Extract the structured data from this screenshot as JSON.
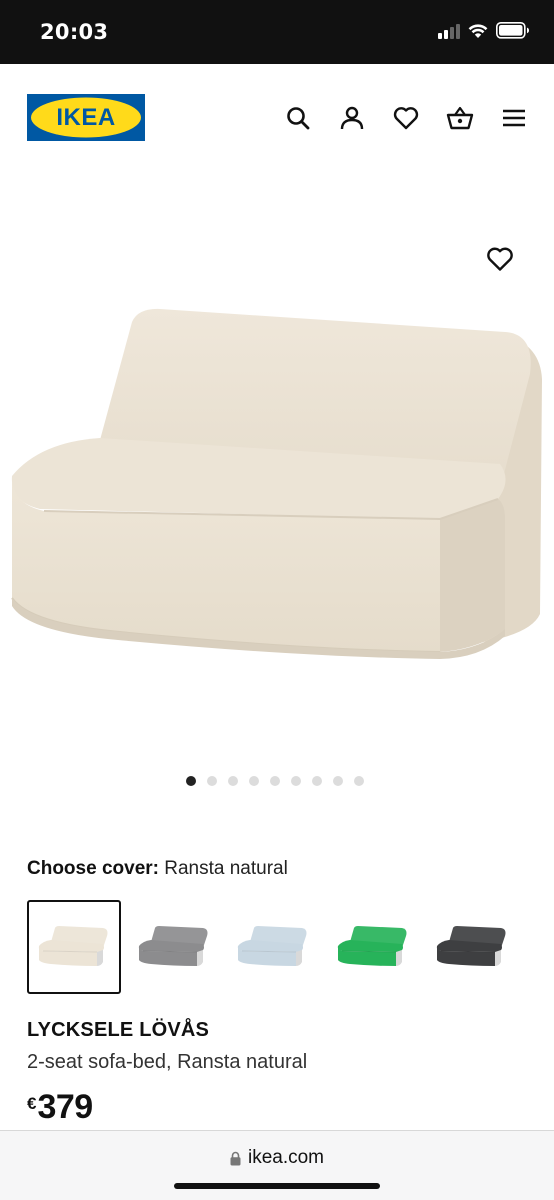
{
  "status_bar": {
    "time": "20:03"
  },
  "header": {
    "logo_text": "IKEA",
    "icons": [
      "search-icon",
      "account-icon",
      "favourites-icon",
      "basket-icon",
      "menu-icon"
    ],
    "brand_blue": "#0058A3",
    "brand_yellow": "#FFDA1A"
  },
  "gallery": {
    "dot_count": 9,
    "active_index": 0
  },
  "cover": {
    "label": "Choose cover:",
    "selected": "Ransta natural",
    "swatches": [
      {
        "name": "Ransta natural",
        "color": "#ece4d6"
      },
      {
        "name": "grey",
        "color": "#8c8c8e"
      },
      {
        "name": "patterned blue",
        "color": "#c8d7e2"
      },
      {
        "name": "green",
        "color": "#27b35a"
      },
      {
        "name": "dark grey",
        "color": "#3e3f41"
      }
    ]
  },
  "product": {
    "name": "LYCKSELE LÖVÅS",
    "description": "2-seat sofa-bed, Ransta natural",
    "currency": "€",
    "price": "379"
  },
  "browser": {
    "url": "ikea.com"
  }
}
